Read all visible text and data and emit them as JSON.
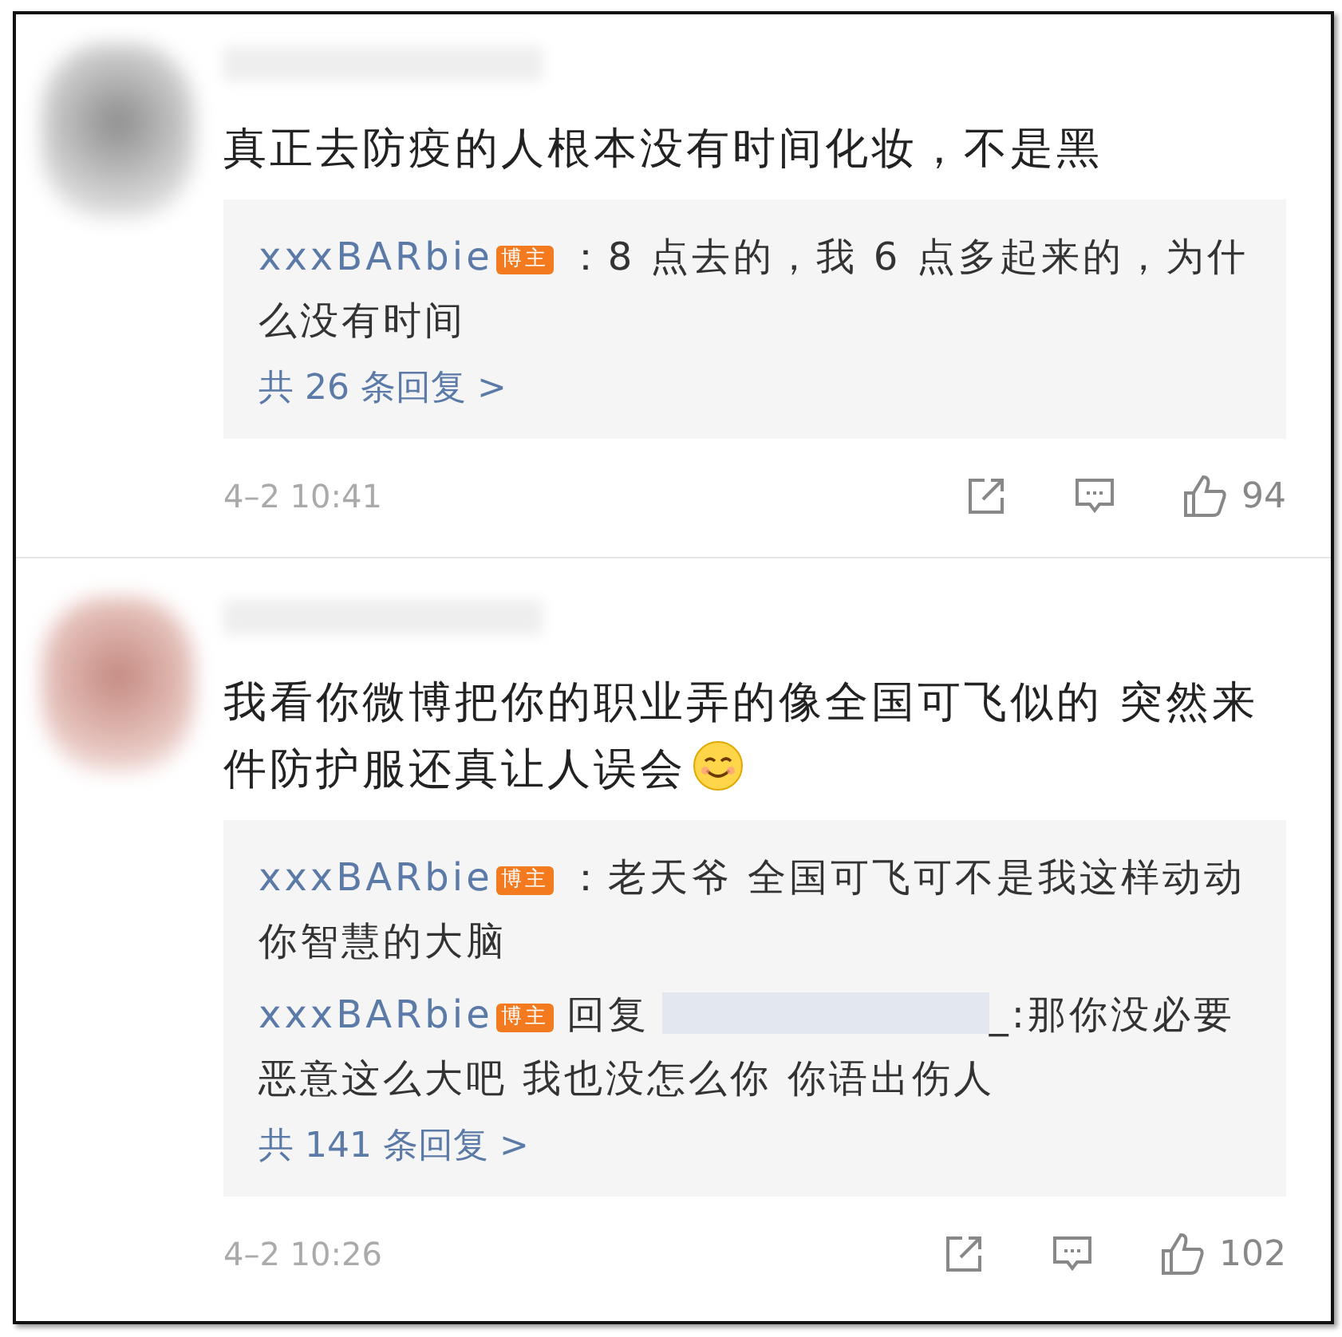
{
  "comments": [
    {
      "text": "真正去防疫的人根本没有时间化妆，不是黑",
      "emoji": false,
      "replies": [
        {
          "kind": "direct",
          "user": "xxxBARbie",
          "badge": "博主",
          "text": "：8 点去的，我 6 点多起来的，为什么没有时间"
        }
      ],
      "more": "共 26 条回复 >",
      "time": "4–2 10:41",
      "likes": "94"
    },
    {
      "text": "我看你微博把你的职业弄的像全国可飞似的 突然来件防护服还真让人误会",
      "emoji": true,
      "replies": [
        {
          "kind": "direct",
          "user": "xxxBARbie",
          "badge": "博主",
          "text": "：老天爷 全国可飞可不是我这样动动你智慧的大脑"
        },
        {
          "kind": "reply_to",
          "user": "xxxBARbie",
          "badge": "博主",
          "verb": "回复",
          "text": "_:那你没必要恶意这么大吧 我也没怎么你 你语出伤人"
        }
      ],
      "more": "共 141 条回复 >",
      "time": "4–2 10:26",
      "likes": "102"
    }
  ]
}
